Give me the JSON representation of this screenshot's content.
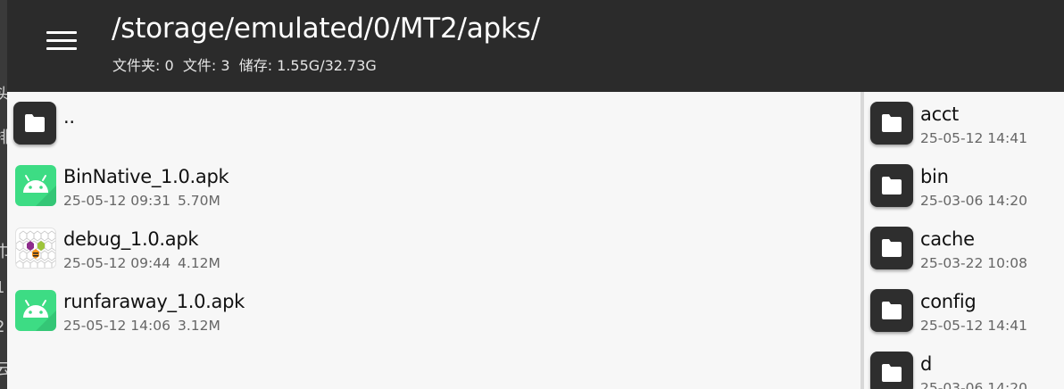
{
  "header": {
    "path": "/storage/emulated/0/MT2/apks/",
    "folders_label": "文件夹: 0",
    "files_label": "文件: 3",
    "storage_label": "储存: 1.55G/32.73G"
  },
  "left_pane": {
    "parent_label": "..",
    "files": [
      {
        "name": "BinNative_1.0.apk",
        "date": "25-05-12 09:31",
        "size": "5.70M",
        "icon": "android-icon"
      },
      {
        "name": "debug_1.0.apk",
        "date": "25-05-12 09:44",
        "size": "4.12M",
        "icon": "honeycomb-app-icon"
      },
      {
        "name": "runfaraway_1.0.apk",
        "date": "25-05-12 14:06",
        "size": "3.12M",
        "icon": "android-icon"
      }
    ]
  },
  "right_pane": {
    "folders": [
      {
        "name": "acct",
        "date": "25-05-12 14:41"
      },
      {
        "name": "bin",
        "date": "25-03-06 14:20"
      },
      {
        "name": "cache",
        "date": "25-03-22 10:08"
      },
      {
        "name": "config",
        "date": "25-05-12 14:41"
      },
      {
        "name": "d",
        "date": "25-03-06 14:20"
      }
    ]
  },
  "colors": {
    "appbar": "#2b2b2b",
    "pane_background": "#f7f7f7",
    "android_green": "#3ddc84",
    "folder_tile": "#2e2e2e"
  }
}
